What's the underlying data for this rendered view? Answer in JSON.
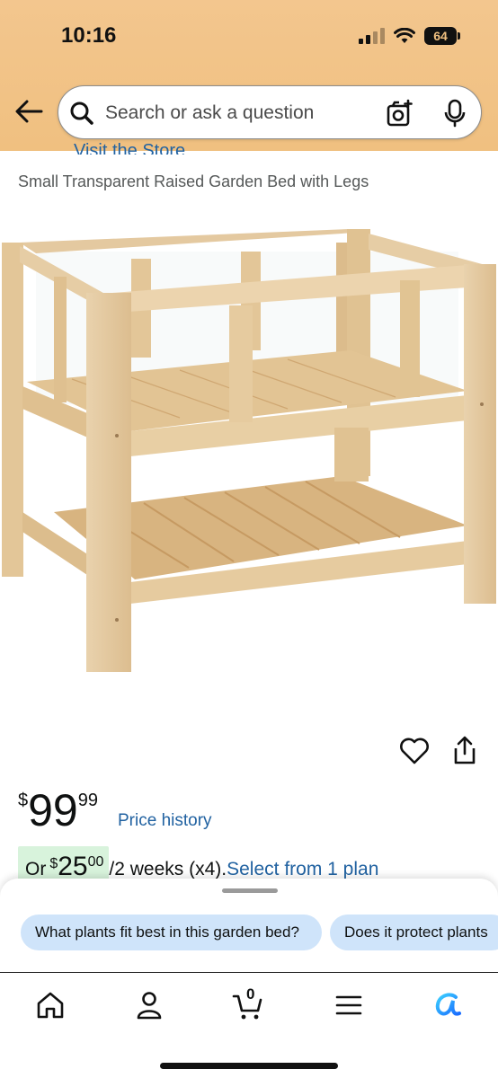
{
  "status_bar": {
    "time": "10:16",
    "battery": "64"
  },
  "search": {
    "placeholder": "Search or ask a question"
  },
  "product": {
    "store_link": "Visit the Store",
    "title": "Small Transparent Raised Garden Bed with Legs",
    "price": {
      "symbol": "$",
      "whole": "99",
      "fraction": "99"
    },
    "price_history_label": "Price history",
    "installment": {
      "prefix": "Or",
      "symbol": "$",
      "whole": "25",
      "fraction": "00",
      "period": "/2 weeks (x4).",
      "plan_link": "Select from 1 plan"
    }
  },
  "suggestions": [
    "What plants fit best in this garden bed?",
    "Does it protect plants"
  ],
  "nav": {
    "items": [
      "home-icon",
      "account-icon",
      "cart-icon",
      "menu-icon",
      "rufus-icon"
    ],
    "cart_count": "0"
  },
  "colors": {
    "header": "#f0c080",
    "link": "#2162a1",
    "chip": "#cfe4fa",
    "installment_badge": "#d8f3dc",
    "rufus_accent": "#1a98ff"
  }
}
